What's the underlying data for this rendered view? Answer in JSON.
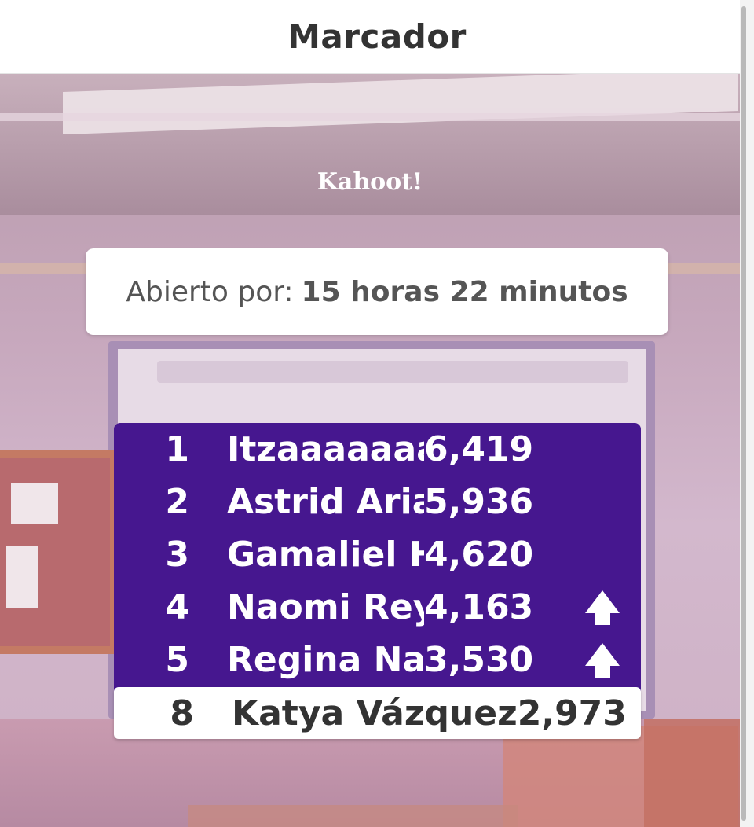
{
  "header": {
    "title": "Marcador"
  },
  "logo": {
    "text": "Kahoot!"
  },
  "open_time": {
    "label": "Abierto por:",
    "value": "15 horas 22 minutos"
  },
  "leaderboard": {
    "rows": [
      {
        "rank": "1",
        "name": "Itzaaaaaaa",
        "score": "6,419",
        "trend": ""
      },
      {
        "rank": "2",
        "name": "Astrid Arias",
        "score": "5,936",
        "trend": ""
      },
      {
        "rank": "3",
        "name": "Gamaliel H",
        "score": "4,620",
        "trend": ""
      },
      {
        "rank": "4",
        "name": "Naomi Reyes",
        "score": "4,163",
        "trend": "up-arrow-icon"
      },
      {
        "rank": "5",
        "name": "Regina Nava",
        "score": "3,530",
        "trend": "up-arrow-icon"
      }
    ],
    "current_player": {
      "rank": "8",
      "name": "Katya Vázquez",
      "score": "2,973"
    }
  },
  "colors": {
    "panel": "#46178f",
    "header_text": "#333333",
    "card_text": "#555555"
  }
}
